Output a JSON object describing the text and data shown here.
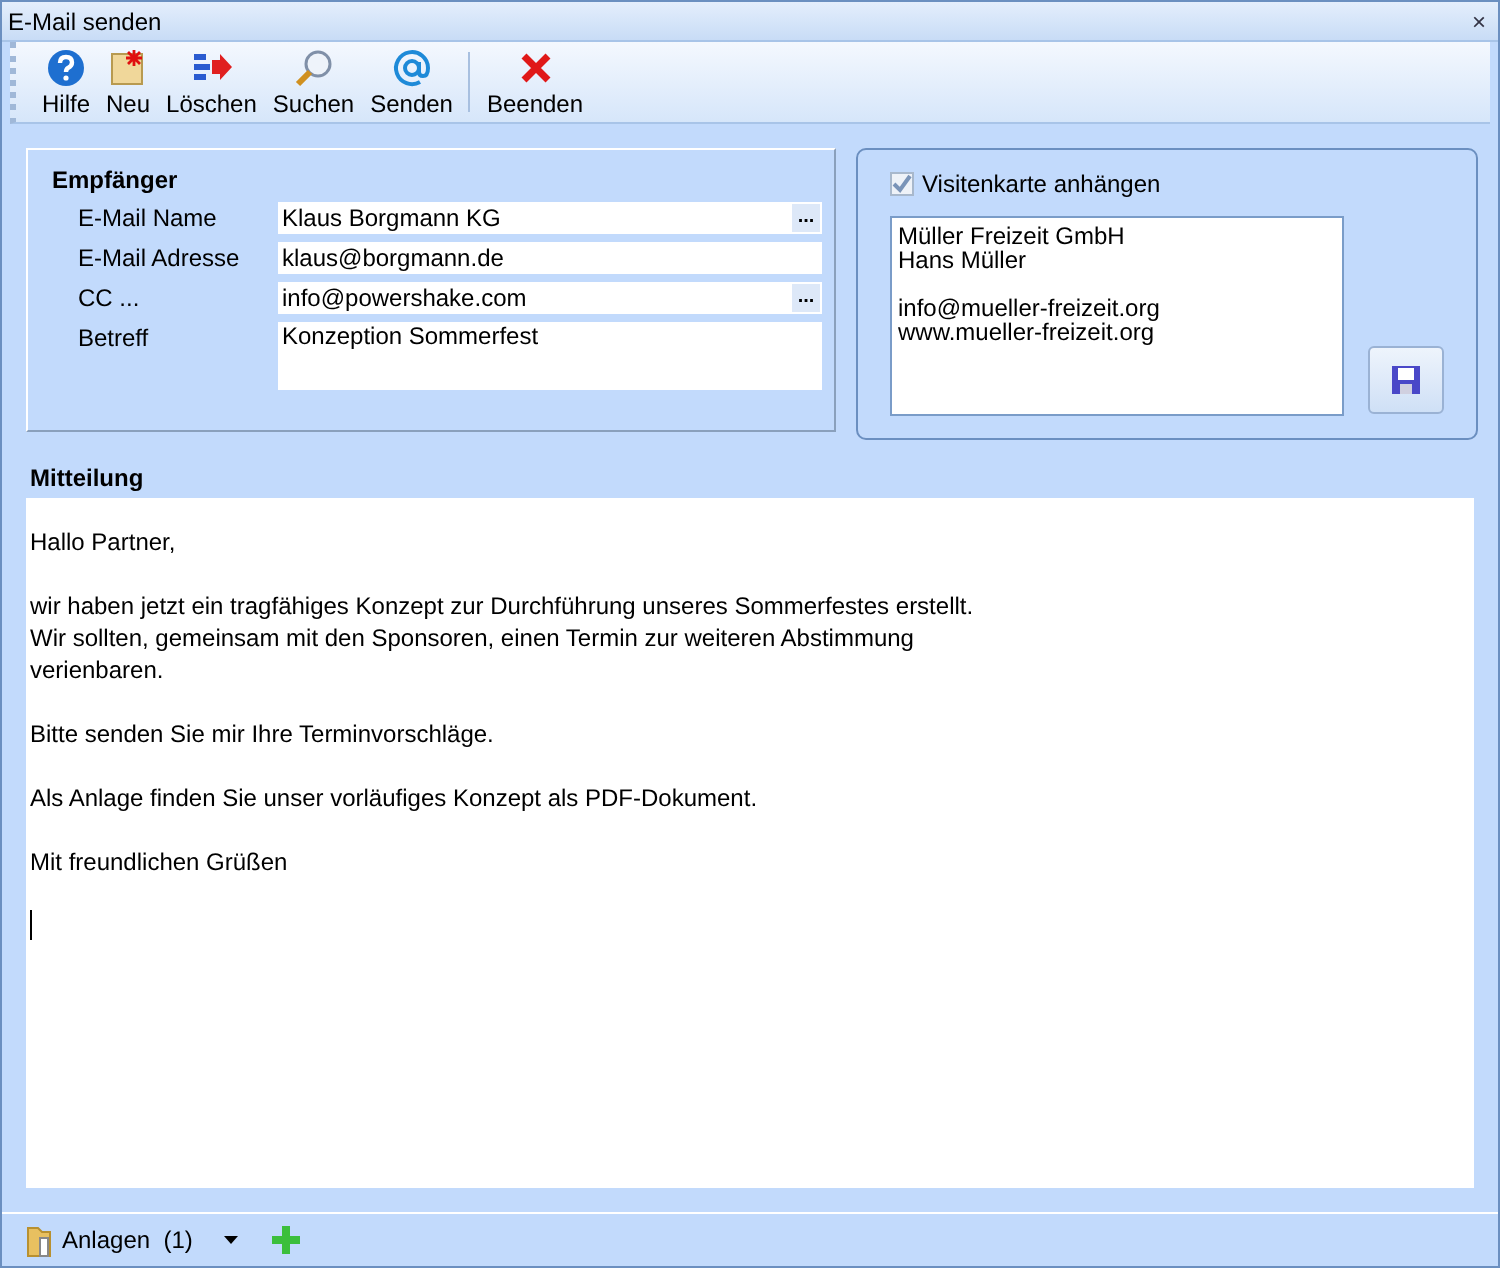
{
  "window": {
    "title": "E-Mail senden",
    "close": "×"
  },
  "toolbar": [
    {
      "label": "Hilfe",
      "kind": "help"
    },
    {
      "label": "Neu",
      "kind": "new"
    },
    {
      "label": "Löschen",
      "kind": "delete"
    },
    {
      "label": "Suchen",
      "kind": "search"
    },
    {
      "label": "Senden",
      "kind": "send"
    },
    {
      "label": "Beenden",
      "kind": "exit",
      "separator_before": true
    }
  ],
  "recipient": {
    "title": "Empfänger",
    "fields": [
      {
        "label": "E-Mail Name",
        "value": "Klaus Borgmann KG",
        "browse": "..."
      },
      {
        "label": "E-Mail Adresse",
        "value": "klaus@borgmann.de"
      },
      {
        "label": "CC ...",
        "value": "info@powershake.com",
        "browse": "..."
      },
      {
        "label": "Betreff",
        "value": "Konzeption Sommerfest",
        "multiline": true
      }
    ]
  },
  "business_card": {
    "label": "Visitenkarte anhängen",
    "checked": true,
    "paragraphs": [
      [
        "Müller Freizeit GmbH",
        "Hans Müller"
      ],
      [
        "info@mueller-freizeit.org",
        "www.mueller-freizeit.org"
      ]
    ]
  },
  "message": {
    "title": "Mitteilung",
    "paragraphs": [
      [
        "Hallo Partner,"
      ],
      [
        "wir haben jetzt ein tragfähiges Konzept zur Durchführung unseres Sommerfestes erstellt.",
        "Wir sollten, gemeinsam mit den Sponsoren, einen Termin zur weiteren Abstimmung",
        "verienbaren."
      ],
      [
        "Bitte senden Sie mir Ihre Terminvorschläge."
      ],
      [
        "Als Anlage finden Sie unser vorläufiges Konzept als PDF-Dokument."
      ],
      [
        "Mit freundlichen Grüßen"
      ]
    ]
  },
  "attachments": {
    "label": "Anlagen  (1)"
  }
}
